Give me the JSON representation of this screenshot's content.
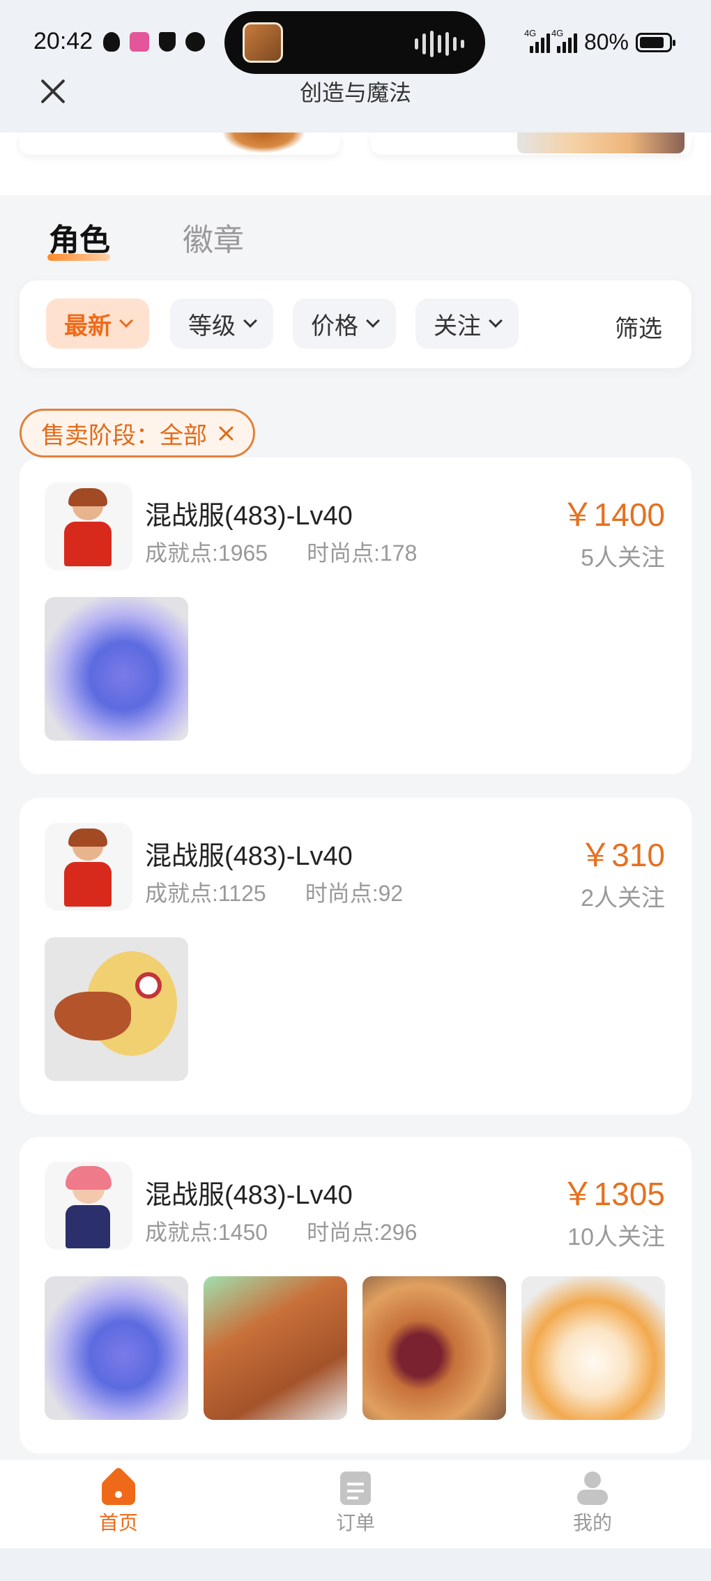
{
  "status_bar": {
    "time": "20:42",
    "battery": "80%",
    "network": "4G"
  },
  "header": {
    "title": "创造与魔法"
  },
  "tabs": [
    {
      "label": "角色",
      "active": true
    },
    {
      "label": "徽章",
      "active": false
    }
  ],
  "filters": {
    "sort_chips": [
      {
        "label": "最新",
        "active": true
      },
      {
        "label": "等级",
        "active": false
      },
      {
        "label": "价格",
        "active": false
      },
      {
        "label": "关注",
        "active": false
      }
    ],
    "filter_label": "筛选"
  },
  "stage_tag": {
    "label": "售卖阶段：全部"
  },
  "listings": [
    {
      "title": "混战服(483)-Lv40",
      "achievement": "成就点:1965",
      "fashion": "时尚点:178",
      "price": "￥1400",
      "followers": "5人关注",
      "thumb_count": 1
    },
    {
      "title": "混战服(483)-Lv40",
      "achievement": "成就点:1125",
      "fashion": "时尚点:92",
      "price": "￥310",
      "followers": "2人关注",
      "thumb_count": 1
    },
    {
      "title": "混战服(483)-Lv40",
      "achievement": "成就点:1450",
      "fashion": "时尚点:296",
      "price": "￥1305",
      "followers": "10人关注",
      "thumb_count": 4
    }
  ],
  "bottom_nav": [
    {
      "label": "首页",
      "icon": "home-icon",
      "active": true
    },
    {
      "label": "订单",
      "icon": "order-icon",
      "active": false
    },
    {
      "label": "我的",
      "icon": "profile-icon",
      "active": false
    }
  ],
  "colors": {
    "accent": "#ef6a18",
    "price": "#e5701f",
    "background": "#f4f5f7"
  }
}
